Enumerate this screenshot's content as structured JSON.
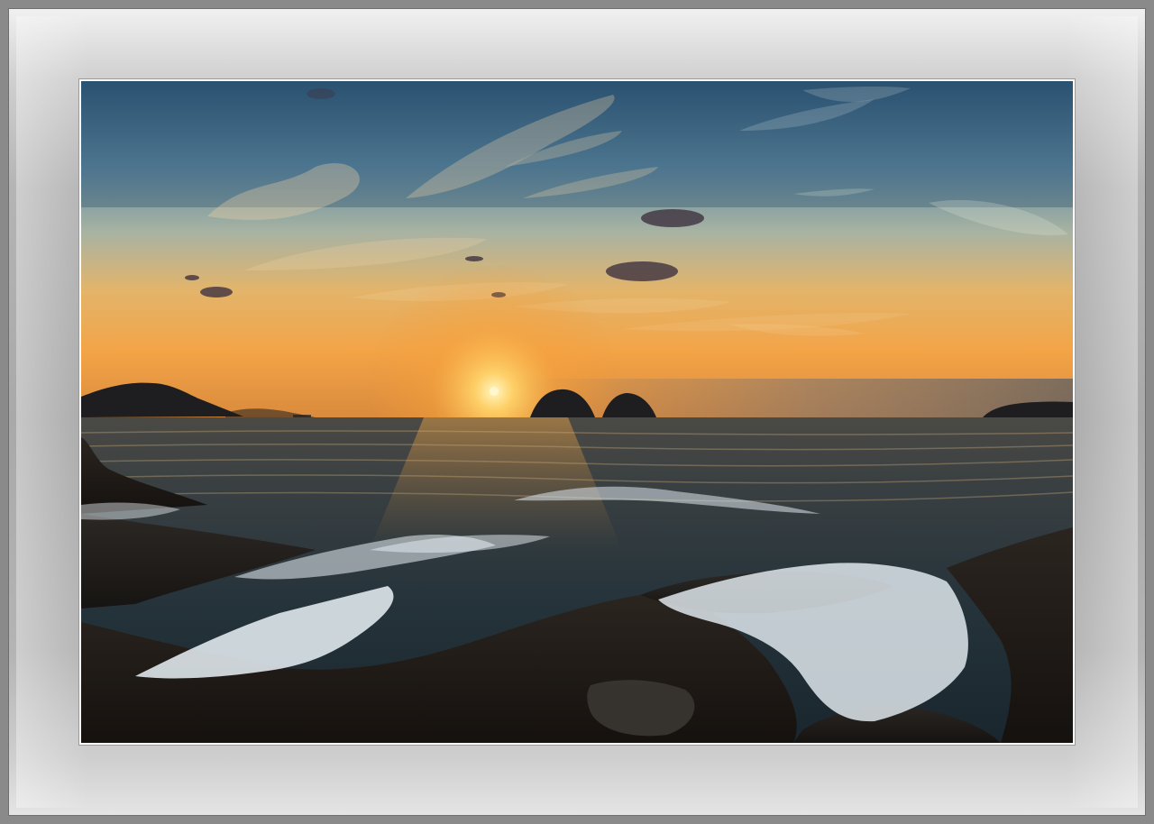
{
  "scene": {
    "subject": "sunset-over-sea-with-rocky-shore",
    "colors": {
      "sky_top": "#2f5a78",
      "sky_mid": "#7ea2b3",
      "sky_horizon": "#f0a24a",
      "sun": "#fff4b0",
      "sea_dark": "#1d2d35",
      "foam": "#e8f0f5",
      "rock": "#1e1a17",
      "frame_light": "#f1f1f1",
      "frame_dark": "#8a8a8a"
    }
  }
}
